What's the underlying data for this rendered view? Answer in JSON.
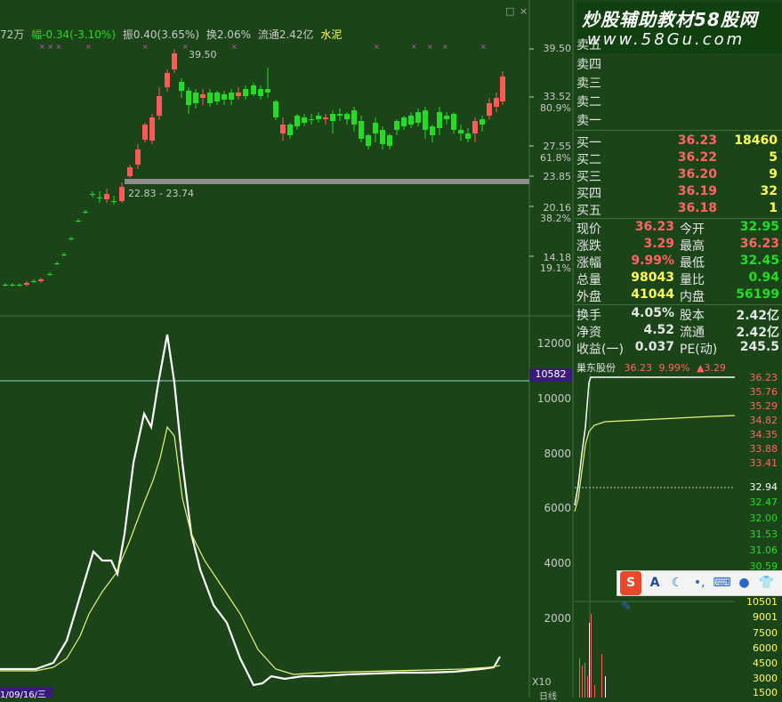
{
  "header": {
    "volume_suffix": "72万",
    "amplitude_change": "幅-0.34(-3.10%)",
    "swing": "振0.40(3.65%)",
    "turnover": "换2.06%",
    "float_cap": "流通2.42亿",
    "sector": "水泥"
  },
  "window_buttons": [
    "□",
    "×"
  ],
  "watermark": {
    "line1": "炒股辅助教材58股网",
    "line2": "www.58Gu.com"
  },
  "price_axis": [
    "39.50",
    "33.52",
    "80.9%",
    "27.55",
    "61.8%",
    "23.85",
    "20.16",
    "38.2%",
    "14.18",
    "19.1%"
  ],
  "chart_annotations": {
    "high_label": "39.50",
    "range_label": "22.83 - 23.74"
  },
  "indicator_axis": [
    "12000",
    "10000",
    "8000",
    "6000",
    "4000",
    "2000"
  ],
  "indicator_marker": "10582",
  "indicator_scale": "X10",
  "bottom_left_date": "1/09/16/三",
  "bottom_right_label": "日线",
  "order_book": {
    "asks": [
      {
        "label": "卖五",
        "price": "",
        "vol": ""
      },
      {
        "label": "卖四",
        "price": "",
        "vol": ""
      },
      {
        "label": "卖三",
        "price": "",
        "vol": ""
      },
      {
        "label": "卖二",
        "price": "",
        "vol": ""
      },
      {
        "label": "卖一",
        "price": "",
        "vol": ""
      }
    ],
    "bids": [
      {
        "label": "买一",
        "price": "36.23",
        "vol": "18460"
      },
      {
        "label": "买二",
        "price": "36.22",
        "vol": "5"
      },
      {
        "label": "买三",
        "price": "36.20",
        "vol": "9"
      },
      {
        "label": "买四",
        "price": "36.19",
        "vol": "32"
      },
      {
        "label": "买五",
        "price": "36.18",
        "vol": "1"
      }
    ]
  },
  "quote": {
    "now_label": "现价",
    "now": "36.23",
    "open_label": "今开",
    "open": "32.95",
    "chg_label": "涨跌",
    "chg": "3.29",
    "high_label": "最高",
    "high": "36.23",
    "pct_label": "涨幅",
    "pct": "9.99%",
    "low_label": "最低",
    "low": "32.45",
    "vol_label": "总量",
    "vol": "98043",
    "ratio_label": "量比",
    "ratio": "0.94",
    "out_label": "外盘",
    "out": "41044",
    "in_label": "内盘",
    "in": "56199",
    "turn_label": "换手",
    "turn": "4.05%",
    "cap_label": "股本",
    "cap": "2.42亿",
    "nav_label": "净资",
    "nav": "4.52",
    "float_label": "流通",
    "float": "2.42亿",
    "eps_label": "收益(一)",
    "eps": "0.037",
    "pe_label": "PE(动)",
    "pe": "245.5"
  },
  "mini_chart": {
    "name": "巢东股份",
    "price": "36.23",
    "pct": "9.99%",
    "chg": "▲3.29",
    "ticks": [
      "36.23",
      "35.76",
      "35.29",
      "34.82",
      "34.35",
      "33.88",
      "33.41",
      "32.94",
      "32.47",
      "32.00",
      "31.53",
      "31.06",
      "30.59"
    ],
    "vol_ticks": [
      "10501",
      "9001",
      "7500",
      "6000",
      "4500",
      "3000",
      "1500"
    ]
  },
  "ime_toolbar": {
    "logo": "S",
    "mode": "A",
    "icons": [
      "moon-icon",
      "punct-icon",
      "keyboard-icon",
      "user-icon",
      "shirt-icon",
      "tool-icon"
    ]
  },
  "colors": {
    "bg": "#1b4418",
    "up": "#ff5a5a",
    "down": "#22dd22",
    "line_white": "#ffffff",
    "line_yellow": "#e8f57a"
  }
}
